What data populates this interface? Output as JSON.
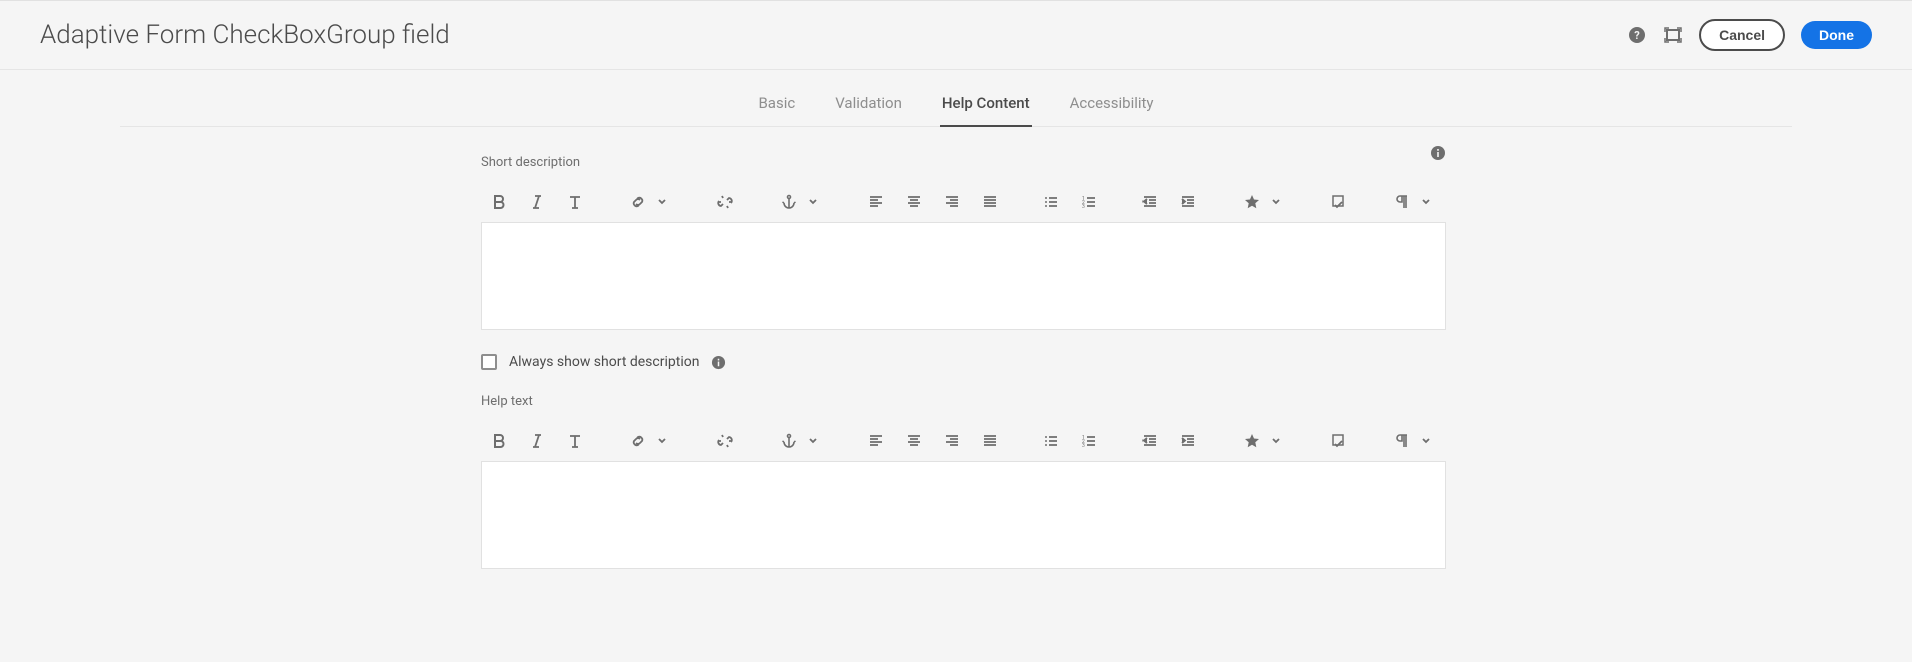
{
  "header": {
    "title": "Adaptive Form CheckBoxGroup field",
    "cancel_label": "Cancel",
    "done_label": "Done"
  },
  "tabs": {
    "items": [
      {
        "label": "Basic",
        "active": false
      },
      {
        "label": "Validation",
        "active": false
      },
      {
        "label": "Help Content",
        "active": true
      },
      {
        "label": "Accessibility",
        "active": false
      }
    ]
  },
  "fields": {
    "short_description": {
      "label": "Short description",
      "value": ""
    },
    "always_show": {
      "label": "Always show short description",
      "checked": false
    },
    "help_text": {
      "label": "Help text",
      "value": ""
    }
  },
  "toolbar_icons": [
    "bold",
    "italic",
    "text-style",
    "link",
    "chevron",
    "unlink",
    "anchor",
    "chevron",
    "align-left",
    "align-center",
    "align-right",
    "align-justify",
    "list-ul",
    "list-ol",
    "outdent",
    "indent",
    "star",
    "chevron",
    "spellcheck",
    "paragraph",
    "chevron"
  ]
}
